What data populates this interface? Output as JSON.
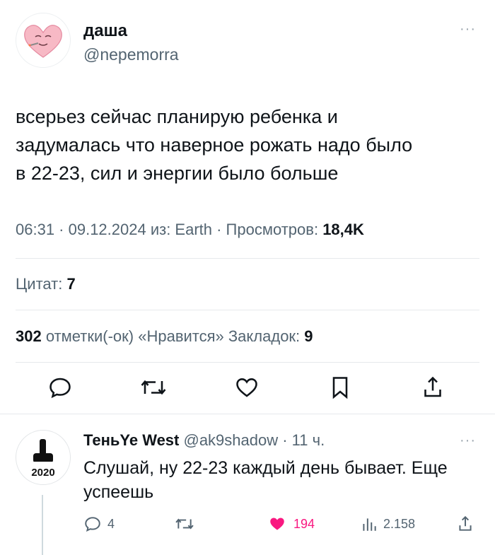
{
  "tweet": {
    "author_name": "даша",
    "author_handle": "@nepemorra",
    "more_label": "···",
    "text_lines": [
      "всерьез сейчас планирую ребенка и",
      "задумалась что наверное рожать надо было",
      "в 22-23, сил и энергии было больше"
    ],
    "meta_prefix": "06:31 · 09.12.2024 из: Earth · Просмотров: ",
    "views": "18,4K",
    "quotes_label": "Цитат: ",
    "quotes_count": "7",
    "likes_count": "302",
    "likes_label": " отметки(-ок) «Нравится»  Закладок: ",
    "bookmarks_count": "9"
  },
  "actions": {
    "icons": [
      "reply-icon",
      "retweet-icon",
      "like-icon",
      "bookmark-icon",
      "share-icon"
    ]
  },
  "reply": {
    "author_name": "ТеньYe West",
    "author_meta": " @ak9shadow · 11 ч.",
    "more_label": "···",
    "text": "Слушай, ну 22-23 каждый день бывает. Еще успеешь",
    "reply_count": "4",
    "like_count": "194",
    "view_count": "2.158",
    "avatar_caption": "2020"
  },
  "colors": {
    "text": "#0f1419",
    "secondary": "#536471",
    "like": "#f91880",
    "divider": "#e6e9ec"
  }
}
